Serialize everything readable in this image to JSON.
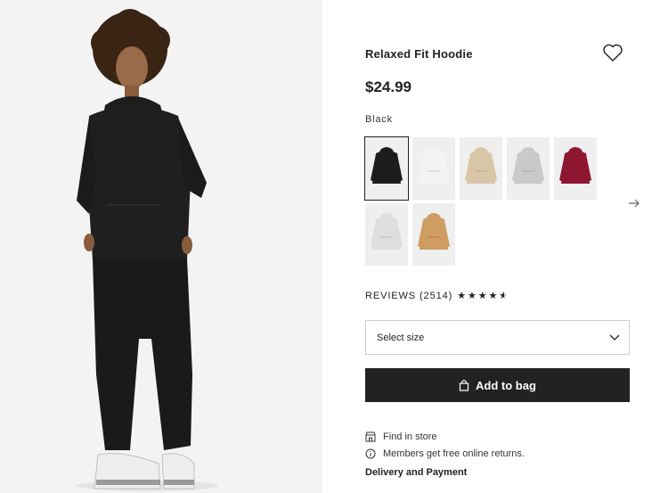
{
  "product": {
    "title": "Relaxed Fit Hoodie",
    "price": "$24.99",
    "color_label": "Black",
    "favorite_icon": "heart-outline-icon"
  },
  "swatches": [
    {
      "name": "Black",
      "color": "#1c1c1c",
      "selected": true
    },
    {
      "name": "White",
      "color": "#f3f3f3",
      "selected": false
    },
    {
      "name": "Beige",
      "color": "#d9c6a6",
      "selected": false
    },
    {
      "name": "Light grey",
      "color": "#c9c9c9",
      "selected": false
    },
    {
      "name": "Burgundy",
      "color": "#8f1630",
      "selected": false
    },
    {
      "name": "Light grey marl",
      "color": "#dedede",
      "selected": false
    },
    {
      "name": "Caramel",
      "color": "#cf9c62",
      "selected": false
    }
  ],
  "reviews": {
    "label": "REVIEWS (2514)",
    "rating": 4.5
  },
  "size": {
    "placeholder": "Select size"
  },
  "cta": {
    "label": "Add to bag"
  },
  "info": {
    "store": "Find in store",
    "returns": "Members get free online returns.",
    "delivery": "Delivery and Payment"
  },
  "colors": {
    "cta_bg": "#222222",
    "text": "#222222",
    "hero_bg": "#f4f4f4"
  }
}
